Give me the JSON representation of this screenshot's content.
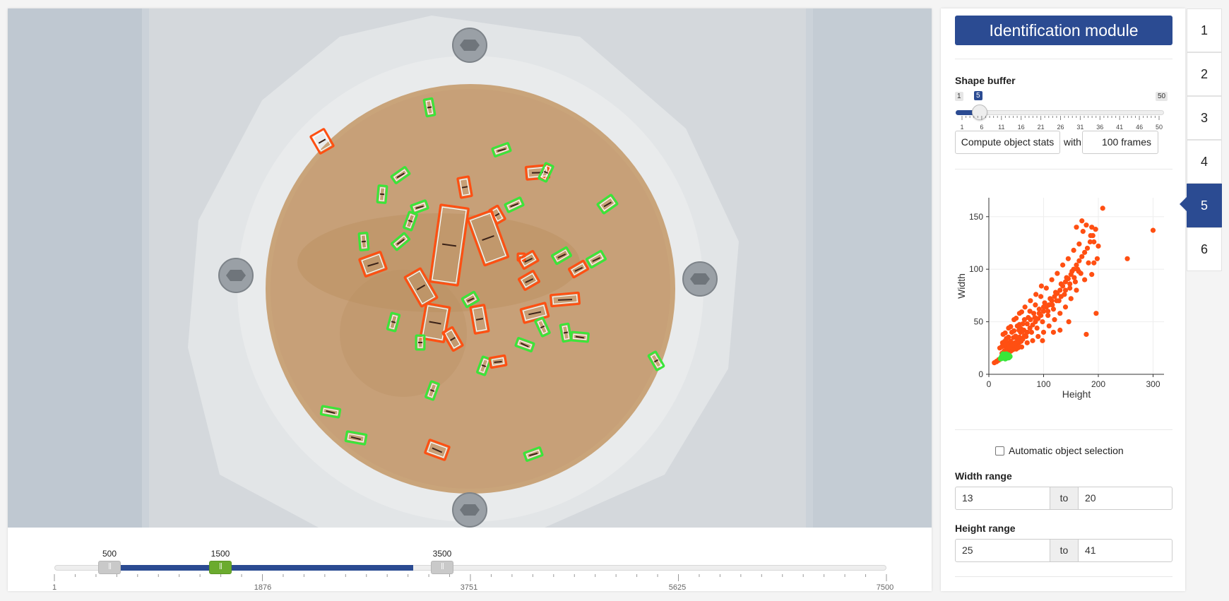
{
  "timeline": {
    "handles": [
      {
        "label": "500",
        "value": 500,
        "color": "gray"
      },
      {
        "label": "1500",
        "value": 1500,
        "color": "green"
      },
      {
        "label": "3500",
        "value": 3500,
        "color": "gray"
      }
    ],
    "min": 1,
    "max": 7500,
    "tick_labels": [
      "1",
      "1876",
      "3751",
      "5625",
      "7500"
    ]
  },
  "panel": {
    "title": "Identification module",
    "shape_buffer": {
      "label": "Shape buffer",
      "min_label": "1",
      "max_label": "50",
      "current_label": "5",
      "value": 5,
      "tick_labels": [
        "1",
        "6",
        "11",
        "16",
        "21",
        "26",
        "31",
        "36",
        "41",
        "46",
        "50"
      ]
    },
    "compute_button": "Compute object stats",
    "with_label": "with",
    "frames_value": "100 frames",
    "auto_selection_label": "Automatic object selection",
    "auto_selection_checked": false,
    "width_range": {
      "label": "Width range",
      "from": "13",
      "to_label": "to",
      "to": "20"
    },
    "height_range": {
      "label": "Height range",
      "from": "25",
      "to_label": "to",
      "to": "41"
    }
  },
  "tabs": [
    "1",
    "2",
    "3",
    "4",
    "5",
    "6"
  ],
  "active_tab": "5",
  "colors": {
    "accent": "#2b4b92",
    "selected": "#39e639",
    "unselected": "#ff4f12",
    "handle_green": "#6bab2e"
  },
  "chart_data": {
    "type": "scatter",
    "xlabel": "Height",
    "ylabel": "Width",
    "xlim": [
      0,
      320
    ],
    "ylim": [
      0,
      168
    ],
    "x_ticks": [
      "0",
      "100",
      "200",
      "300"
    ],
    "y_ticks": [
      "0",
      "50",
      "100",
      "150"
    ],
    "grid": true,
    "series": [
      {
        "color": "#ff4f12",
        "points": [
          [
            10,
            11
          ],
          [
            14,
            12
          ],
          [
            18,
            14
          ],
          [
            22,
            15
          ],
          [
            26,
            17
          ],
          [
            30,
            19
          ],
          [
            34,
            20
          ],
          [
            38,
            22
          ],
          [
            42,
            24
          ],
          [
            46,
            25
          ],
          [
            50,
            28
          ],
          [
            55,
            30
          ],
          [
            60,
            34
          ],
          [
            65,
            37
          ],
          [
            70,
            40
          ],
          [
            75,
            44
          ],
          [
            80,
            47
          ],
          [
            85,
            50
          ],
          [
            90,
            53
          ],
          [
            95,
            56
          ],
          [
            100,
            60
          ],
          [
            105,
            64
          ],
          [
            110,
            66
          ],
          [
            115,
            70
          ],
          [
            120,
            74
          ],
          [
            125,
            77
          ],
          [
            130,
            80
          ],
          [
            135,
            84
          ],
          [
            140,
            88
          ],
          [
            145,
            91
          ],
          [
            150,
            95
          ],
          [
            155,
            100
          ],
          [
            160,
            104
          ],
          [
            165,
            108
          ],
          [
            170,
            112
          ],
          [
            175,
            116
          ],
          [
            180,
            120
          ],
          [
            185,
            126
          ],
          [
            190,
            132
          ],
          [
            195,
            138
          ],
          [
            200,
            122
          ],
          [
            198,
            110
          ],
          [
            188,
            95
          ],
          [
            175,
            90
          ],
          [
            160,
            80
          ],
          [
            150,
            72
          ],
          [
            140,
            64
          ],
          [
            130,
            58
          ],
          [
            120,
            52
          ],
          [
            110,
            46
          ],
          [
            100,
            40
          ],
          [
            90,
            36
          ],
          [
            80,
            32
          ],
          [
            70,
            30
          ],
          [
            60,
            26
          ],
          [
            50,
            24
          ],
          [
            40,
            22
          ],
          [
            35,
            28
          ],
          [
            45,
            35
          ],
          [
            55,
            42
          ],
          [
            65,
            52
          ],
          [
            75,
            60
          ],
          [
            85,
            66
          ],
          [
            95,
            74
          ],
          [
            105,
            82
          ],
          [
            115,
            90
          ],
          [
            125,
            96
          ],
          [
            135,
            104
          ],
          [
            145,
            110
          ],
          [
            155,
            118
          ],
          [
            165,
            124
          ],
          [
            172,
            136
          ],
          [
            178,
            142
          ],
          [
            186,
            132
          ],
          [
            192,
            126
          ],
          [
            196,
            58
          ],
          [
            182,
            106
          ],
          [
            168,
            96
          ],
          [
            158,
            88
          ],
          [
            148,
            82
          ],
          [
            138,
            76
          ],
          [
            128,
            70
          ],
          [
            118,
            62
          ],
          [
            108,
            56
          ],
          [
            98,
            50
          ],
          [
            88,
            44
          ],
          [
            78,
            40
          ],
          [
            68,
            36
          ],
          [
            58,
            32
          ],
          [
            48,
            30
          ],
          [
            38,
            26
          ],
          [
            28,
            22
          ],
          [
            25,
            30
          ],
          [
            32,
            34
          ],
          [
            42,
            40
          ],
          [
            52,
            46
          ],
          [
            62,
            48
          ],
          [
            72,
            54
          ],
          [
            82,
            58
          ],
          [
            92,
            62
          ],
          [
            102,
            68
          ],
          [
            112,
            72
          ],
          [
            122,
            78
          ],
          [
            132,
            86
          ],
          [
            142,
            92
          ],
          [
            152,
            98
          ],
          [
            162,
            100
          ],
          [
            96,
            84
          ],
          [
            86,
            76
          ],
          [
            76,
            70
          ],
          [
            66,
            64
          ],
          [
            56,
            58
          ],
          [
            46,
            52
          ],
          [
            36,
            44
          ],
          [
            26,
            38
          ],
          [
            20,
            25
          ],
          [
            24,
            20
          ],
          [
            28,
            27
          ],
          [
            32,
            24
          ],
          [
            36,
            30
          ],
          [
            44,
            28
          ],
          [
            52,
            34
          ],
          [
            58,
            40
          ],
          [
            64,
            42
          ],
          [
            70,
            48
          ],
          [
            76,
            52
          ],
          [
            84,
            54
          ],
          [
            92,
            58
          ],
          [
            100,
            64
          ],
          [
            108,
            60
          ],
          [
            116,
            66
          ],
          [
            124,
            70
          ],
          [
            132,
            74
          ],
          [
            140,
            80
          ],
          [
            148,
            86
          ],
          [
            156,
            92
          ],
          [
            164,
            98
          ],
          [
            208,
            158
          ],
          [
            300,
            137
          ],
          [
            253,
            110
          ],
          [
            178,
            38
          ],
          [
            130,
            42
          ],
          [
            146,
            50
          ],
          [
            118,
            40
          ],
          [
            98,
            32
          ],
          [
            160,
            140
          ],
          [
            170,
            146
          ],
          [
            188,
            140
          ],
          [
            192,
            106
          ]
        ]
      },
      {
        "color": "#39e639",
        "points": [
          [
            22,
            15
          ],
          [
            24,
            17
          ],
          [
            26,
            16
          ],
          [
            28,
            18
          ],
          [
            30,
            17
          ],
          [
            32,
            19
          ],
          [
            34,
            16
          ],
          [
            36,
            18
          ],
          [
            38,
            17
          ],
          [
            26,
            19
          ],
          [
            30,
            15
          ],
          [
            34,
            18
          ],
          [
            28,
            16
          ],
          [
            32,
            17
          ],
          [
            36,
            16
          ]
        ]
      }
    ]
  }
}
